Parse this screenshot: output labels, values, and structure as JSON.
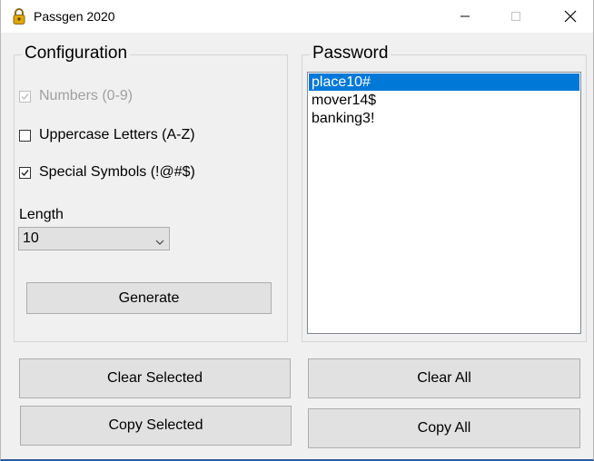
{
  "window": {
    "title": "Passgen 2020",
    "icon": "padlock-icon"
  },
  "config": {
    "title": "Configuration",
    "numbers": {
      "label": "Numbers (0-9)",
      "checked": true,
      "enabled": false
    },
    "uppercase": {
      "label": "Uppercase Letters (A-Z)",
      "checked": false,
      "enabled": true
    },
    "special": {
      "label": "Special Symbols (!@#$)",
      "checked": true,
      "enabled": true
    },
    "length_label": "Length",
    "length_value": "10",
    "generate_label": "Generate"
  },
  "password": {
    "title": "Password",
    "items": [
      "place10#",
      "mover14$",
      "banking3!"
    ],
    "selected_index": 0
  },
  "actions": {
    "clear_selected": "Clear Selected",
    "copy_selected": "Copy Selected",
    "clear_all": "Clear All",
    "copy_all": "Copy All"
  },
  "colors": {
    "selection": "#0078d7",
    "window_bg": "#f0f0f0",
    "button_bg": "#e1e1e1"
  }
}
